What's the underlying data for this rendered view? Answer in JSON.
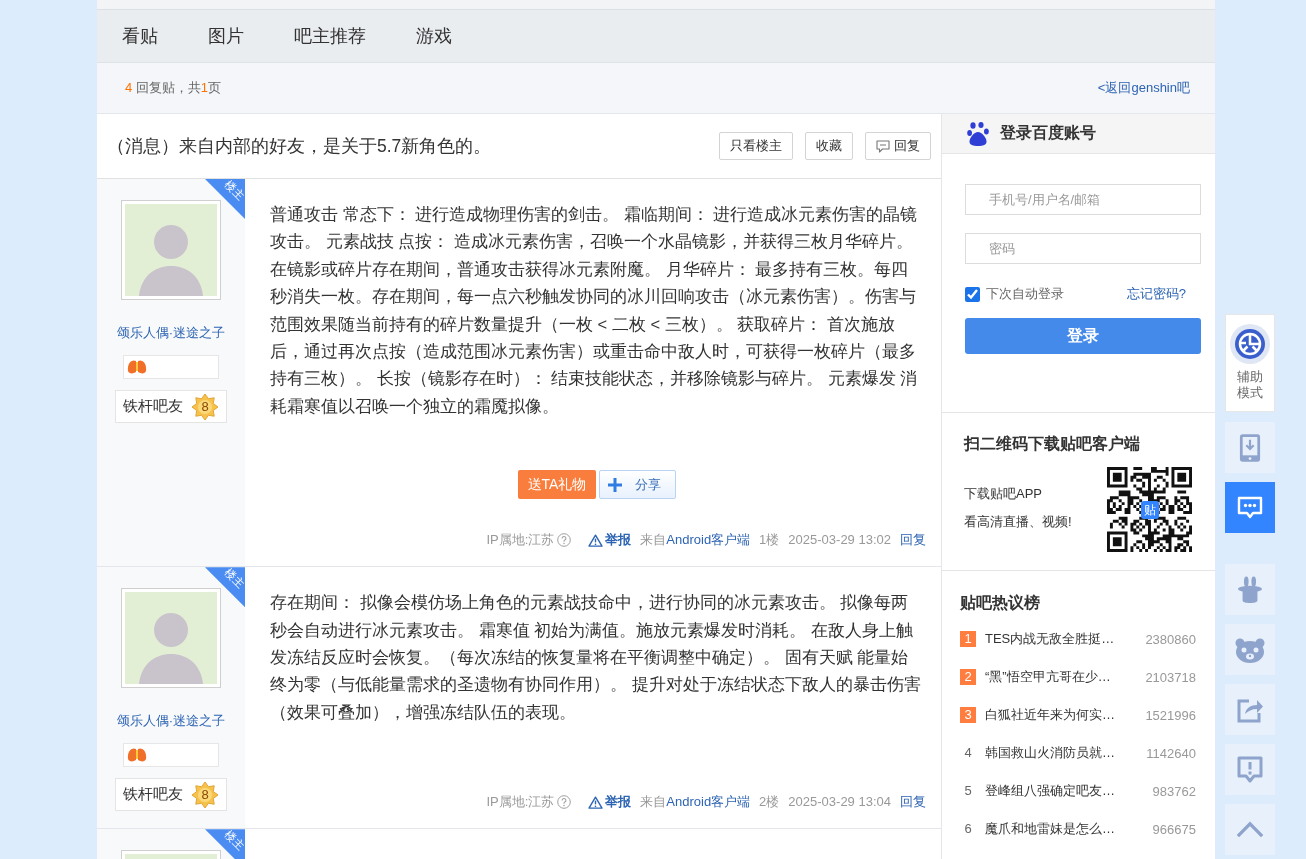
{
  "nav": {
    "tabs": [
      {
        "label": "看贴",
        "selected": false
      },
      {
        "label": "图片",
        "selected": false
      },
      {
        "label": "吧主推荐",
        "selected": false
      },
      {
        "label": "游戏",
        "selected": false
      }
    ]
  },
  "thread_bar": {
    "reply_count": "4",
    "reply_label": " 回复贴，共",
    "page_count": "1",
    "page_label": "页",
    "back_link": "<返回genshin吧"
  },
  "thread": {
    "title": "（消息）来自内部的好友，是关于5.7新角色的。",
    "actions": [
      {
        "kind": "author_only",
        "label": "只看楼主"
      },
      {
        "kind": "favorite",
        "label": "收藏"
      },
      {
        "kind": "reply",
        "label": "回复"
      }
    ]
  },
  "posts": [
    {
      "ribbon": "楼主",
      "author": "颂乐人偶·迷途之子",
      "rank_title": "铁杆吧友",
      "rank": "8",
      "body": "普通攻击 常态下： 进行造成物理伤害的剑击。 霜临期间： 进行造成冰元素伤害的晶镜攻击。 元素战技 点按： 造成冰元素伤害，召唤一个水晶镜影，并获得三枚月华碎片。在镜影或碎片存在期间，普通攻击获得冰元素附魔。 月华碎片： 最多持有三枚。每四秒消失一枚。存在期间，每一点六秒触发协同的冰川回响攻击（冰元素伤害）。伤害与范围效果随当前持有的碎片数量提升（一枚 < 二枚 < 三枚）。 获取碎片： 首次施放后，通过再次点按（造成范围冰元素伤害）或重击命中敌人时，可获得一枚碎片（最多持有三枚）。 长按（镜影存在时）： 结束技能状态，并移除镜影与碎片。 元素爆发 消耗霜寒值以召唤一个独立的霜魇拟像。",
      "gift": "送TA礼物",
      "share": "分享",
      "ip": "IP属地:江苏",
      "report": "举报",
      "source_label": "来自",
      "source": "Android客户端",
      "floor": "1楼",
      "time": "2025-03-29 13:02",
      "reply": "回复"
    },
    {
      "ribbon": "楼主",
      "author": "颂乐人偶·迷途之子",
      "rank_title": "铁杆吧友",
      "rank": "8",
      "body": "存在期间： 拟像会模仿场上角色的元素战技命中，进行协同的冰元素攻击。 拟像每两秒会自动进行冰元素攻击。 霜寒值 初始为满值。施放元素爆发时消耗。 在敌人身上触发冻结反应时会恢复。（每次冻结的恢复量将在平衡调整中确定）。 固有天赋 能量始终为零（与低能量需求的圣遗物有协同作用）。 提升对处于冻结状态下敌人的暴击伤害（效果可叠加），增强冻结队伍的表现。",
      "ip": "IP属地:江苏",
      "report": "举报",
      "source_label": "来自",
      "source": "Android客户端",
      "floor": "2楼",
      "time": "2025-03-29 13:04",
      "reply": "回复"
    },
    {
      "ribbon": "楼主"
    }
  ],
  "sidebar": {
    "login": {
      "title": "登录百度账号",
      "username_placeholder": "手机号/用户名/邮箱",
      "password_placeholder": "密码",
      "remember": {
        "label": "下次自动登录",
        "checked": true
      },
      "forgot": "忘记密码?",
      "submit": "登录"
    },
    "app": {
      "title": "扫二维码下载贴吧客户端",
      "line1": "下载贴吧APP",
      "line2": "看高清直播、视频!",
      "qr_logo": "贴"
    },
    "hot": {
      "title": "贴吧热议榜",
      "items": [
        {
          "rank": "1",
          "title": "TES内战无敌全胜挺…",
          "count": "2380860",
          "highlighted": true
        },
        {
          "rank": "2",
          "title": "“黑”悟空甲亢哥在少…",
          "count": "2103718",
          "highlighted": true
        },
        {
          "rank": "3",
          "title": "白狐社近年来为何实…",
          "count": "1521996",
          "highlighted": true
        },
        {
          "rank": "4",
          "title": "韩国救山火消防员就…",
          "count": "1142640",
          "highlighted": false
        },
        {
          "rank": "5",
          "title": "登峰组八强确定吧友…",
          "count": "983762",
          "highlighted": false
        },
        {
          "rank": "6",
          "title": "魔爪和地雷妹是怎么…",
          "count": "966675",
          "highlighted": false
        }
      ]
    }
  },
  "tools": [
    {
      "kind": "accessibility",
      "label": "辅助模式",
      "highlighted": false
    },
    {
      "kind": "download",
      "highlighted": false
    },
    {
      "kind": "chat",
      "highlighted": true
    },
    {
      "kind": "hat",
      "highlighted": false
    },
    {
      "kind": "bear",
      "highlighted": false
    },
    {
      "kind": "share",
      "highlighted": false
    },
    {
      "kind": "report",
      "highlighted": false
    },
    {
      "kind": "top",
      "highlighted": false
    }
  ]
}
